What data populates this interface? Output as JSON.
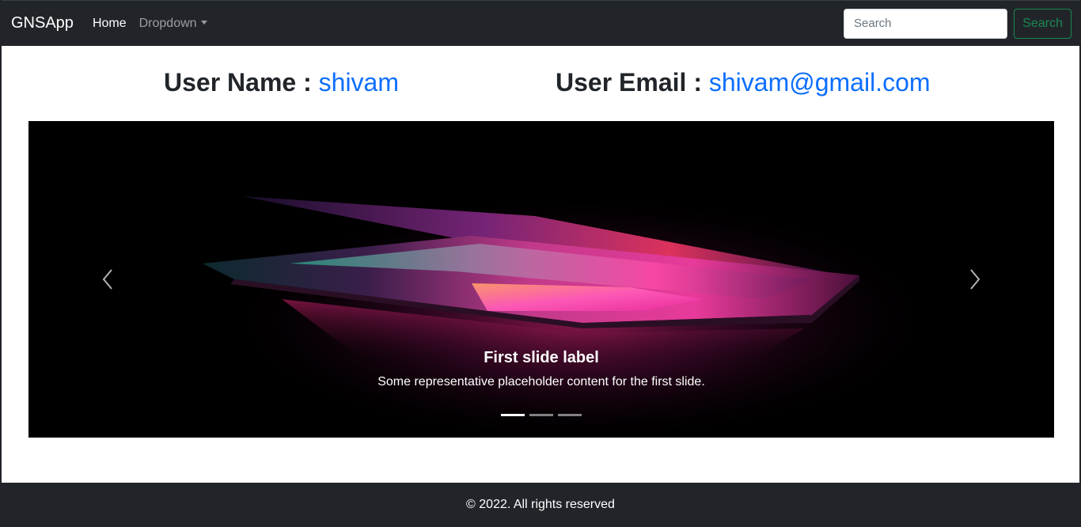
{
  "navbar": {
    "brand": "GNSApp",
    "links": [
      {
        "label": "Home",
        "active": true
      },
      {
        "label": "Dropdown",
        "active": false
      }
    ],
    "search": {
      "placeholder": "Search",
      "value": "",
      "button_label": "Search"
    }
  },
  "user": {
    "name_label": "User Name :",
    "name_value": "shivam",
    "email_label": "User Email :",
    "email_value": "shivam@gmail.com"
  },
  "carousel": {
    "caption_title": "First slide label",
    "caption_text": "Some representative placeholder content for the first slide.",
    "active_slide": 1,
    "slide_count": 3,
    "prev_icon": "chevron-left-icon",
    "next_icon": "chevron-right-icon"
  },
  "footer": {
    "text": "© 2022. All rights reserved"
  },
  "colors": {
    "navbar_bg": "#212529",
    "link_blue": "#0d6efd",
    "success_green": "#198754"
  }
}
